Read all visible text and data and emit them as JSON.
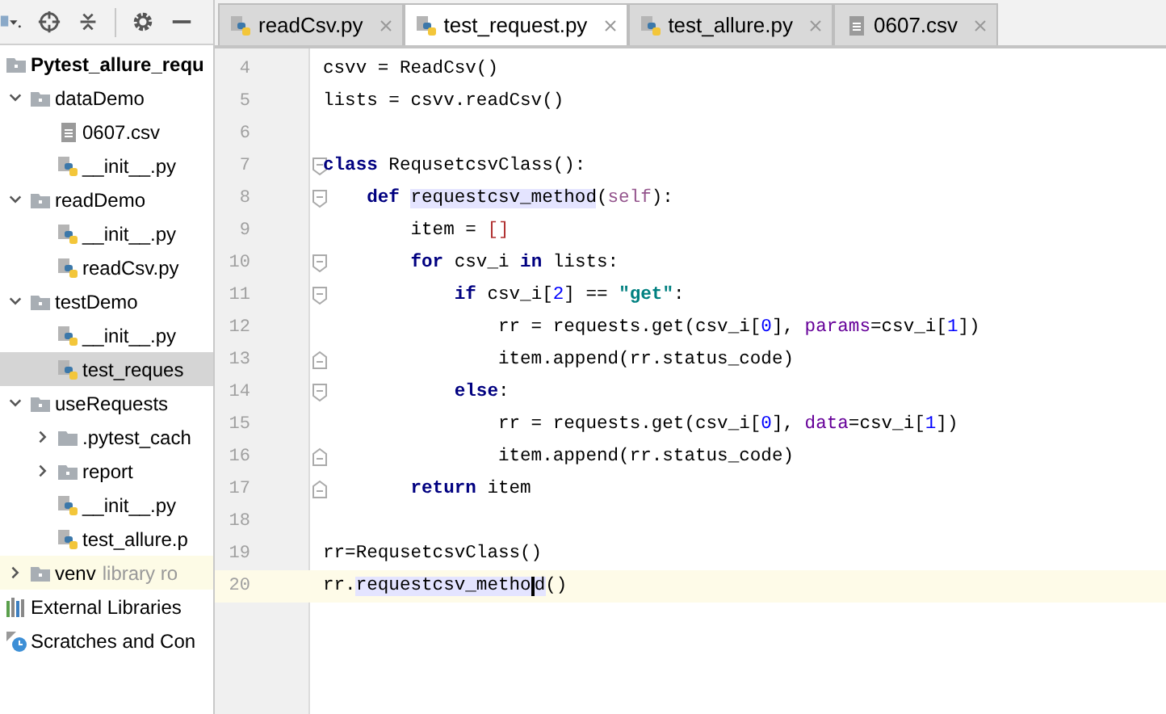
{
  "project_tree": [
    {
      "label": "Pytest_allure_requ",
      "kind": "root",
      "selected": false,
      "highlighted": false,
      "children": [
        {
          "label": "dataDemo",
          "kind": "folder",
          "expanded": true,
          "selected": false,
          "highlighted": false,
          "children": [
            {
              "label": "0607.csv",
              "kind": "csv",
              "selected": false,
              "highlighted": false
            },
            {
              "label": "__init__.py",
              "kind": "python",
              "selected": false,
              "highlighted": false
            }
          ]
        },
        {
          "label": "readDemo",
          "kind": "folder",
          "expanded": true,
          "selected": false,
          "highlighted": false,
          "children": [
            {
              "label": "__init__.py",
              "kind": "python",
              "selected": false,
              "highlighted": false
            },
            {
              "label": "readCsv.py",
              "kind": "python",
              "selected": false,
              "highlighted": false
            }
          ]
        },
        {
          "label": "testDemo",
          "kind": "folder",
          "expanded": true,
          "selected": false,
          "highlighted": false,
          "children": [
            {
              "label": "__init__.py",
              "kind": "python",
              "selected": false,
              "highlighted": false
            },
            {
              "label": "test_reques",
              "kind": "python",
              "selected": true,
              "highlighted": false
            }
          ]
        },
        {
          "label": "useRequests",
          "kind": "folder",
          "expanded": true,
          "selected": false,
          "highlighted": false,
          "children": [
            {
              "label": ".pytest_cach",
              "kind": "plain-folder",
              "expanded": false,
              "selected": false,
              "highlighted": false
            },
            {
              "label": "report",
              "kind": "folder",
              "expanded": false,
              "selected": false,
              "highlighted": false
            },
            {
              "label": "__init__.py",
              "kind": "python",
              "selected": false,
              "highlighted": false
            },
            {
              "label": "test_allure.p",
              "kind": "python",
              "selected": false,
              "highlighted": false
            }
          ]
        },
        {
          "label": "venv",
          "note": "library ro",
          "kind": "folder",
          "expanded": false,
          "selected": false,
          "highlighted": true
        }
      ]
    },
    {
      "label": "External Libraries",
      "kind": "libraries",
      "selected": false,
      "highlighted": false
    },
    {
      "label": "Scratches and Con",
      "kind": "scratches",
      "selected": false,
      "highlighted": false
    }
  ],
  "tabs": [
    {
      "label": "readCsv.py",
      "kind": "python",
      "selected": false
    },
    {
      "label": "test_request.py",
      "kind": "python",
      "selected": true
    },
    {
      "label": "test_allure.py",
      "kind": "python",
      "selected": false
    },
    {
      "label": "0607.csv",
      "kind": "csv",
      "selected": false
    }
  ],
  "code_lines": [
    {
      "number": "4",
      "fold_start": false,
      "fold_end": false,
      "current": false,
      "tokens": [
        {
          "text": "csvv = ReadCsv()",
          "kind": "plain"
        }
      ]
    },
    {
      "number": "5",
      "fold_start": false,
      "fold_end": false,
      "current": false,
      "tokens": [
        {
          "text": "lists = csvv.readCsv()",
          "kind": "plain"
        }
      ]
    },
    {
      "number": "6",
      "fold_start": false,
      "fold_end": false,
      "current": false
    },
    {
      "number": "7",
      "fold_start": true,
      "fold_end": false,
      "current": false,
      "tokens": [
        {
          "text": "class",
          "kind": "keyword"
        },
        {
          "text": " RequsetcsvClass():",
          "kind": "plain"
        }
      ]
    },
    {
      "number": "8",
      "fold_start": true,
      "fold_end": false,
      "current": false,
      "tokens": [
        {
          "text": "    def ",
          "kind": "keyword"
        },
        {
          "text": "requestcsv_method",
          "kind": "usage"
        },
        {
          "text": "(",
          "kind": "plain"
        },
        {
          "text": "self",
          "kind": "self"
        },
        {
          "text": "):",
          "kind": "plain"
        }
      ]
    },
    {
      "number": "9",
      "fold_start": false,
      "fold_end": false,
      "current": false,
      "tokens": [
        {
          "text": "        item = ",
          "kind": "plain"
        },
        {
          "text": "[]",
          "kind": "bracket"
        }
      ]
    },
    {
      "number": "10",
      "fold_start": true,
      "fold_end": false,
      "current": false,
      "tokens": [
        {
          "text": "        for",
          "kind": "keyword"
        },
        {
          "text": " csv_i ",
          "kind": "plain"
        },
        {
          "text": "in",
          "kind": "keyword"
        },
        {
          "text": " lists:",
          "kind": "plain"
        }
      ]
    },
    {
      "number": "11",
      "fold_start": true,
      "fold_end": false,
      "current": false,
      "tokens": [
        {
          "text": "            if",
          "kind": "keyword"
        },
        {
          "text": " csv_i[",
          "kind": "plain"
        },
        {
          "text": "2",
          "kind": "number"
        },
        {
          "text": "] == ",
          "kind": "plain"
        },
        {
          "text": "\"get\"",
          "kind": "string"
        },
        {
          "text": ":",
          "kind": "plain"
        }
      ]
    },
    {
      "number": "12",
      "fold_start": false,
      "fold_end": false,
      "current": false,
      "tokens": [
        {
          "text": "                rr = requests.get(csv_i[",
          "kind": "plain"
        },
        {
          "text": "0",
          "kind": "number"
        },
        {
          "text": "], ",
          "kind": "plain"
        },
        {
          "text": "params",
          "kind": "param"
        },
        {
          "text": "=csv_i[",
          "kind": "plain"
        },
        {
          "text": "1",
          "kind": "number"
        },
        {
          "text": "])",
          "kind": "plain"
        }
      ]
    },
    {
      "number": "13",
      "fold_start": false,
      "fold_end": true,
      "current": false,
      "tokens": [
        {
          "text": "                item.append(rr.status_code)",
          "kind": "plain"
        }
      ]
    },
    {
      "number": "14",
      "fold_start": true,
      "fold_end": false,
      "current": false,
      "tokens": [
        {
          "text": "            else",
          "kind": "keyword"
        },
        {
          "text": ":",
          "kind": "plain"
        }
      ]
    },
    {
      "number": "15",
      "fold_start": false,
      "fold_end": false,
      "current": false,
      "tokens": [
        {
          "text": "                rr = requests.get(csv_i[",
          "kind": "plain"
        },
        {
          "text": "0",
          "kind": "number"
        },
        {
          "text": "], ",
          "kind": "plain"
        },
        {
          "text": "data",
          "kind": "param"
        },
        {
          "text": "=csv_i[",
          "kind": "plain"
        },
        {
          "text": "1",
          "kind": "number"
        },
        {
          "text": "])",
          "kind": "plain"
        }
      ]
    },
    {
      "number": "16",
      "fold_start": false,
      "fold_end": true,
      "current": false,
      "tokens": [
        {
          "text": "                item.append(rr.status_code)",
          "kind": "plain"
        }
      ]
    },
    {
      "number": "17",
      "fold_start": false,
      "fold_end": true,
      "current": false,
      "tokens": [
        {
          "text": "        return",
          "kind": "keyword"
        },
        {
          "text": " item",
          "kind": "plain"
        }
      ]
    },
    {
      "number": "18",
      "fold_start": false,
      "fold_end": false,
      "current": false
    },
    {
      "number": "19",
      "fold_start": false,
      "fold_end": false,
      "current": false,
      "tokens": [
        {
          "text": "rr=RequsetcsvClass()",
          "kind": "plain"
        }
      ]
    },
    {
      "number": "20",
      "fold_start": false,
      "fold_end": false,
      "current": true,
      "tokens": [
        {
          "text": "rr.",
          "kind": "plain"
        },
        {
          "text": "requestcsv_metho",
          "kind": "usage",
          "caret_after": true
        },
        {
          "text": "d",
          "kind": "usage"
        },
        {
          "text": "()",
          "kind": "plain"
        }
      ]
    }
  ]
}
